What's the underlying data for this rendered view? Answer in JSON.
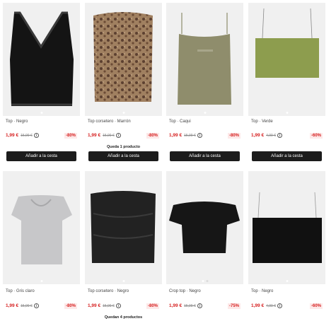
{
  "products": [
    {
      "title": "Top · Negro",
      "price": "1,99 €",
      "old_price": "15,99 €",
      "discount": "-80%",
      "stock": "",
      "button": "Añadir a la cesta"
    },
    {
      "title": "Top corsetero · Marrón",
      "price": "1,99 €",
      "old_price": "15,99 €",
      "discount": "-80%",
      "stock": "Queda 1 producto",
      "button": "Añadir a la cesta"
    },
    {
      "title": "Top · Caqui",
      "price": "1,99 €",
      "old_price": "15,99 €",
      "discount": "-80%",
      "stock": "",
      "button": "Añadir a la cesta"
    },
    {
      "title": "Top · Verde",
      "price": "1,99 €",
      "old_price": "4,99 €",
      "discount": "-60%",
      "stock": "",
      "button": "Añadir a la cesta"
    },
    {
      "title": "Top · Gris claro",
      "price": "1,99 €",
      "old_price": "15,99 €",
      "discount": "-80%",
      "stock": ""
    },
    {
      "title": "Top corsetero · Negro",
      "price": "1,99 €",
      "old_price": "15,99 €",
      "discount": "-80%",
      "stock": "Quedan 4 productos"
    },
    {
      "title": "Crop top · Negro",
      "price": "1,99 €",
      "old_price": "15,99 €",
      "discount": "-75%",
      "stock": ""
    },
    {
      "title": "Top · Negro",
      "price": "1,99 €",
      "old_price": "4,99 €",
      "discount": "-60%",
      "stock": ""
    }
  ],
  "colors": {
    "accent": "#d62020",
    "button": "#1c1c1c",
    "image_bg": "#f0f0f0"
  }
}
